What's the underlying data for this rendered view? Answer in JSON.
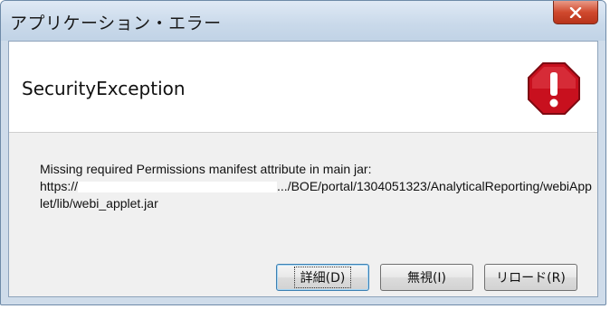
{
  "window": {
    "title": "アプリケーション・エラー",
    "close_label": "X"
  },
  "header": {
    "exception_name": "SecurityException"
  },
  "message": {
    "line1": "Missing required Permissions manifest attribute in main jar:",
    "url_prefix": "https://",
    "url_rest_visible": ".../BOE/portal/1304051323/AnalyticalReporting/webiApplet/lib/webi_applet.jar"
  },
  "buttons": {
    "details": "詳細(D)",
    "ignore": "無視(I)",
    "reload": "リロード(R)"
  },
  "colors": {
    "close_button": "#d0492e",
    "warning_icon": "#c8101e"
  },
  "icons": {
    "close": "close-icon",
    "warning": "error-octagon-icon"
  }
}
